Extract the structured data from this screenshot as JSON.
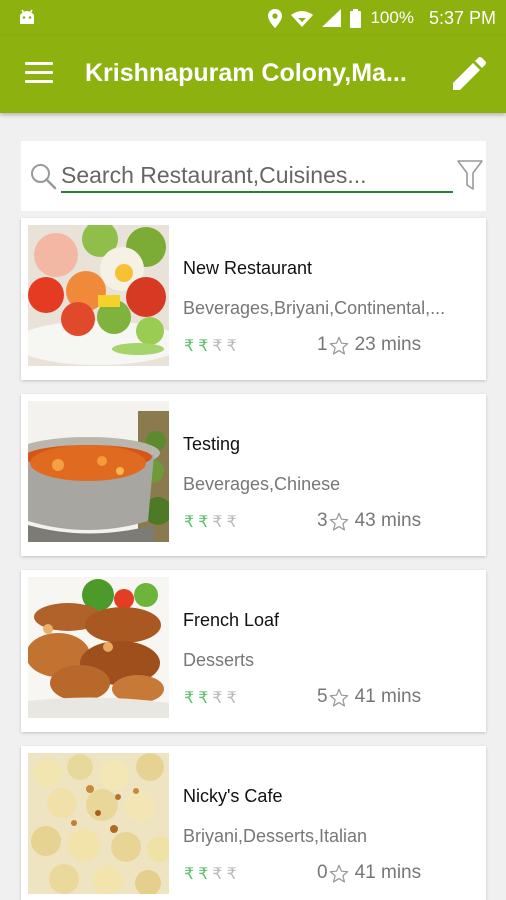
{
  "status_bar": {
    "battery": "100%",
    "time": "5:37 PM"
  },
  "app_bar": {
    "title": "Krishnapuram Colony,Ma..."
  },
  "search": {
    "placeholder": "Search Restaurant,Cuisines..."
  },
  "restaurants": [
    {
      "name": "New Restaurant",
      "cuisines": "Beverages,Briyani,Continental,...",
      "rating": "1",
      "time": "23 mins",
      "price_symbol": "₹",
      "price_level": 2,
      "price_max": 4
    },
    {
      "name": "Testing",
      "cuisines": "Beverages,Chinese",
      "rating": "3",
      "time": "43 mins",
      "price_symbol": "₹",
      "price_level": 2,
      "price_max": 4
    },
    {
      "name": "French Loaf",
      "cuisines": "Desserts",
      "rating": "5",
      "time": "41 mins",
      "price_symbol": "₹",
      "price_level": 2,
      "price_max": 4
    },
    {
      "name": "Nicky's Cafe",
      "cuisines": "Briyani,Desserts,Italian",
      "rating": "0",
      "time": "41 mins",
      "price_symbol": "₹",
      "price_level": 2,
      "price_max": 4
    }
  ],
  "colors": {
    "app_bar": "#8db10f",
    "price_active": "#5ec06a",
    "price_inactive": "#b9b9b9",
    "search_underline": "#2e7d32"
  }
}
